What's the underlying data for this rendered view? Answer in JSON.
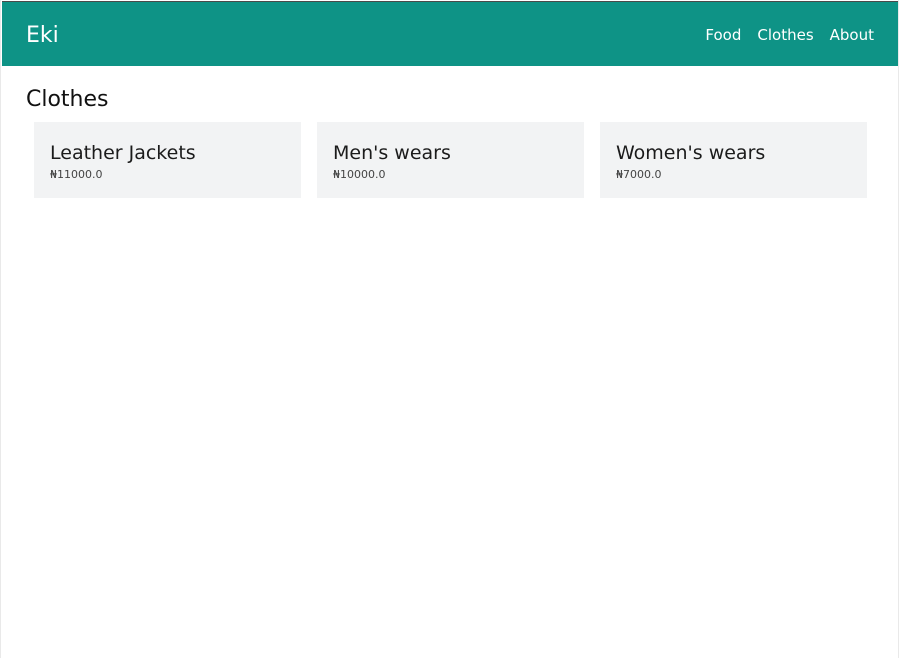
{
  "navbar": {
    "brand": "Eki",
    "links": [
      "Food",
      "Clothes",
      "About"
    ],
    "background": "#0e9386"
  },
  "main": {
    "title": "Clothes",
    "products": [
      {
        "name": "Leather Jackets",
        "price": "₦11000.0"
      },
      {
        "name": "Men's wears",
        "price": "₦10000.0"
      },
      {
        "name": "Women's wears",
        "price": "₦7000.0"
      }
    ]
  }
}
